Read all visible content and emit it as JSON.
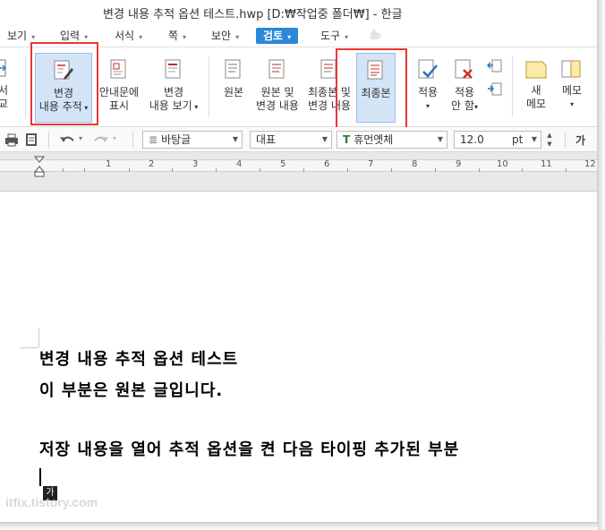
{
  "window": {
    "title": "변경 내용 추적 옵션 테스트.hwp [D:₩작업중 폴더₩] - 한글"
  },
  "menu": {
    "items": [
      {
        "label": "보기"
      },
      {
        "label": "입력"
      },
      {
        "label": "서식"
      },
      {
        "label": "쪽"
      },
      {
        "label": "보안"
      },
      {
        "label": "검토"
      },
      {
        "label": "도구"
      }
    ]
  },
  "ribbon": {
    "cut_label_1": "서",
    "cut_label_2": "교",
    "track_changes": {
      "line1": "변경",
      "line2": "내용 추적"
    },
    "show_in_balloons": {
      "line1": "안내문에",
      "line2": "표시"
    },
    "view_changes": {
      "line1": "변경",
      "line2": "내용 보기"
    },
    "original": {
      "line1": "원본"
    },
    "original_and_changes": {
      "line1": "원본 및",
      "line2": "변경 내용"
    },
    "final_and_changes": {
      "line1": "최종본 및",
      "line2": "변경 내용"
    },
    "final": {
      "line1": "최종본"
    },
    "apply": {
      "line1": "적용"
    },
    "reject": {
      "line1": "적용",
      "line2": "안 함"
    },
    "new_memo": {
      "line1": "새",
      "line2": "메모"
    },
    "memo": {
      "line1": "메모"
    }
  },
  "toolbar": {
    "style": "바탕글",
    "language": "대표",
    "font": "휴먼옛체",
    "size": "12.0",
    "unit": "pt",
    "char_shape": "가"
  },
  "ruler": {
    "numbers": [
      "1",
      "2",
      "3",
      "4",
      "5",
      "6",
      "7",
      "8",
      "9",
      "10",
      "11",
      "12"
    ]
  },
  "document": {
    "lines": [
      "변경 내용 추적 옵션 테스트",
      "이 부분은 원본 글입니다.",
      "저장 내용을 열어 추적 옵션을 켠 다음 타이핑 추가된 부분"
    ],
    "ime_indicator": "가"
  },
  "watermark": "itfix.tistory.com",
  "colors": {
    "accent": "#2b88d8",
    "highlight": "#e53935",
    "selected": "#d4e4f7"
  }
}
